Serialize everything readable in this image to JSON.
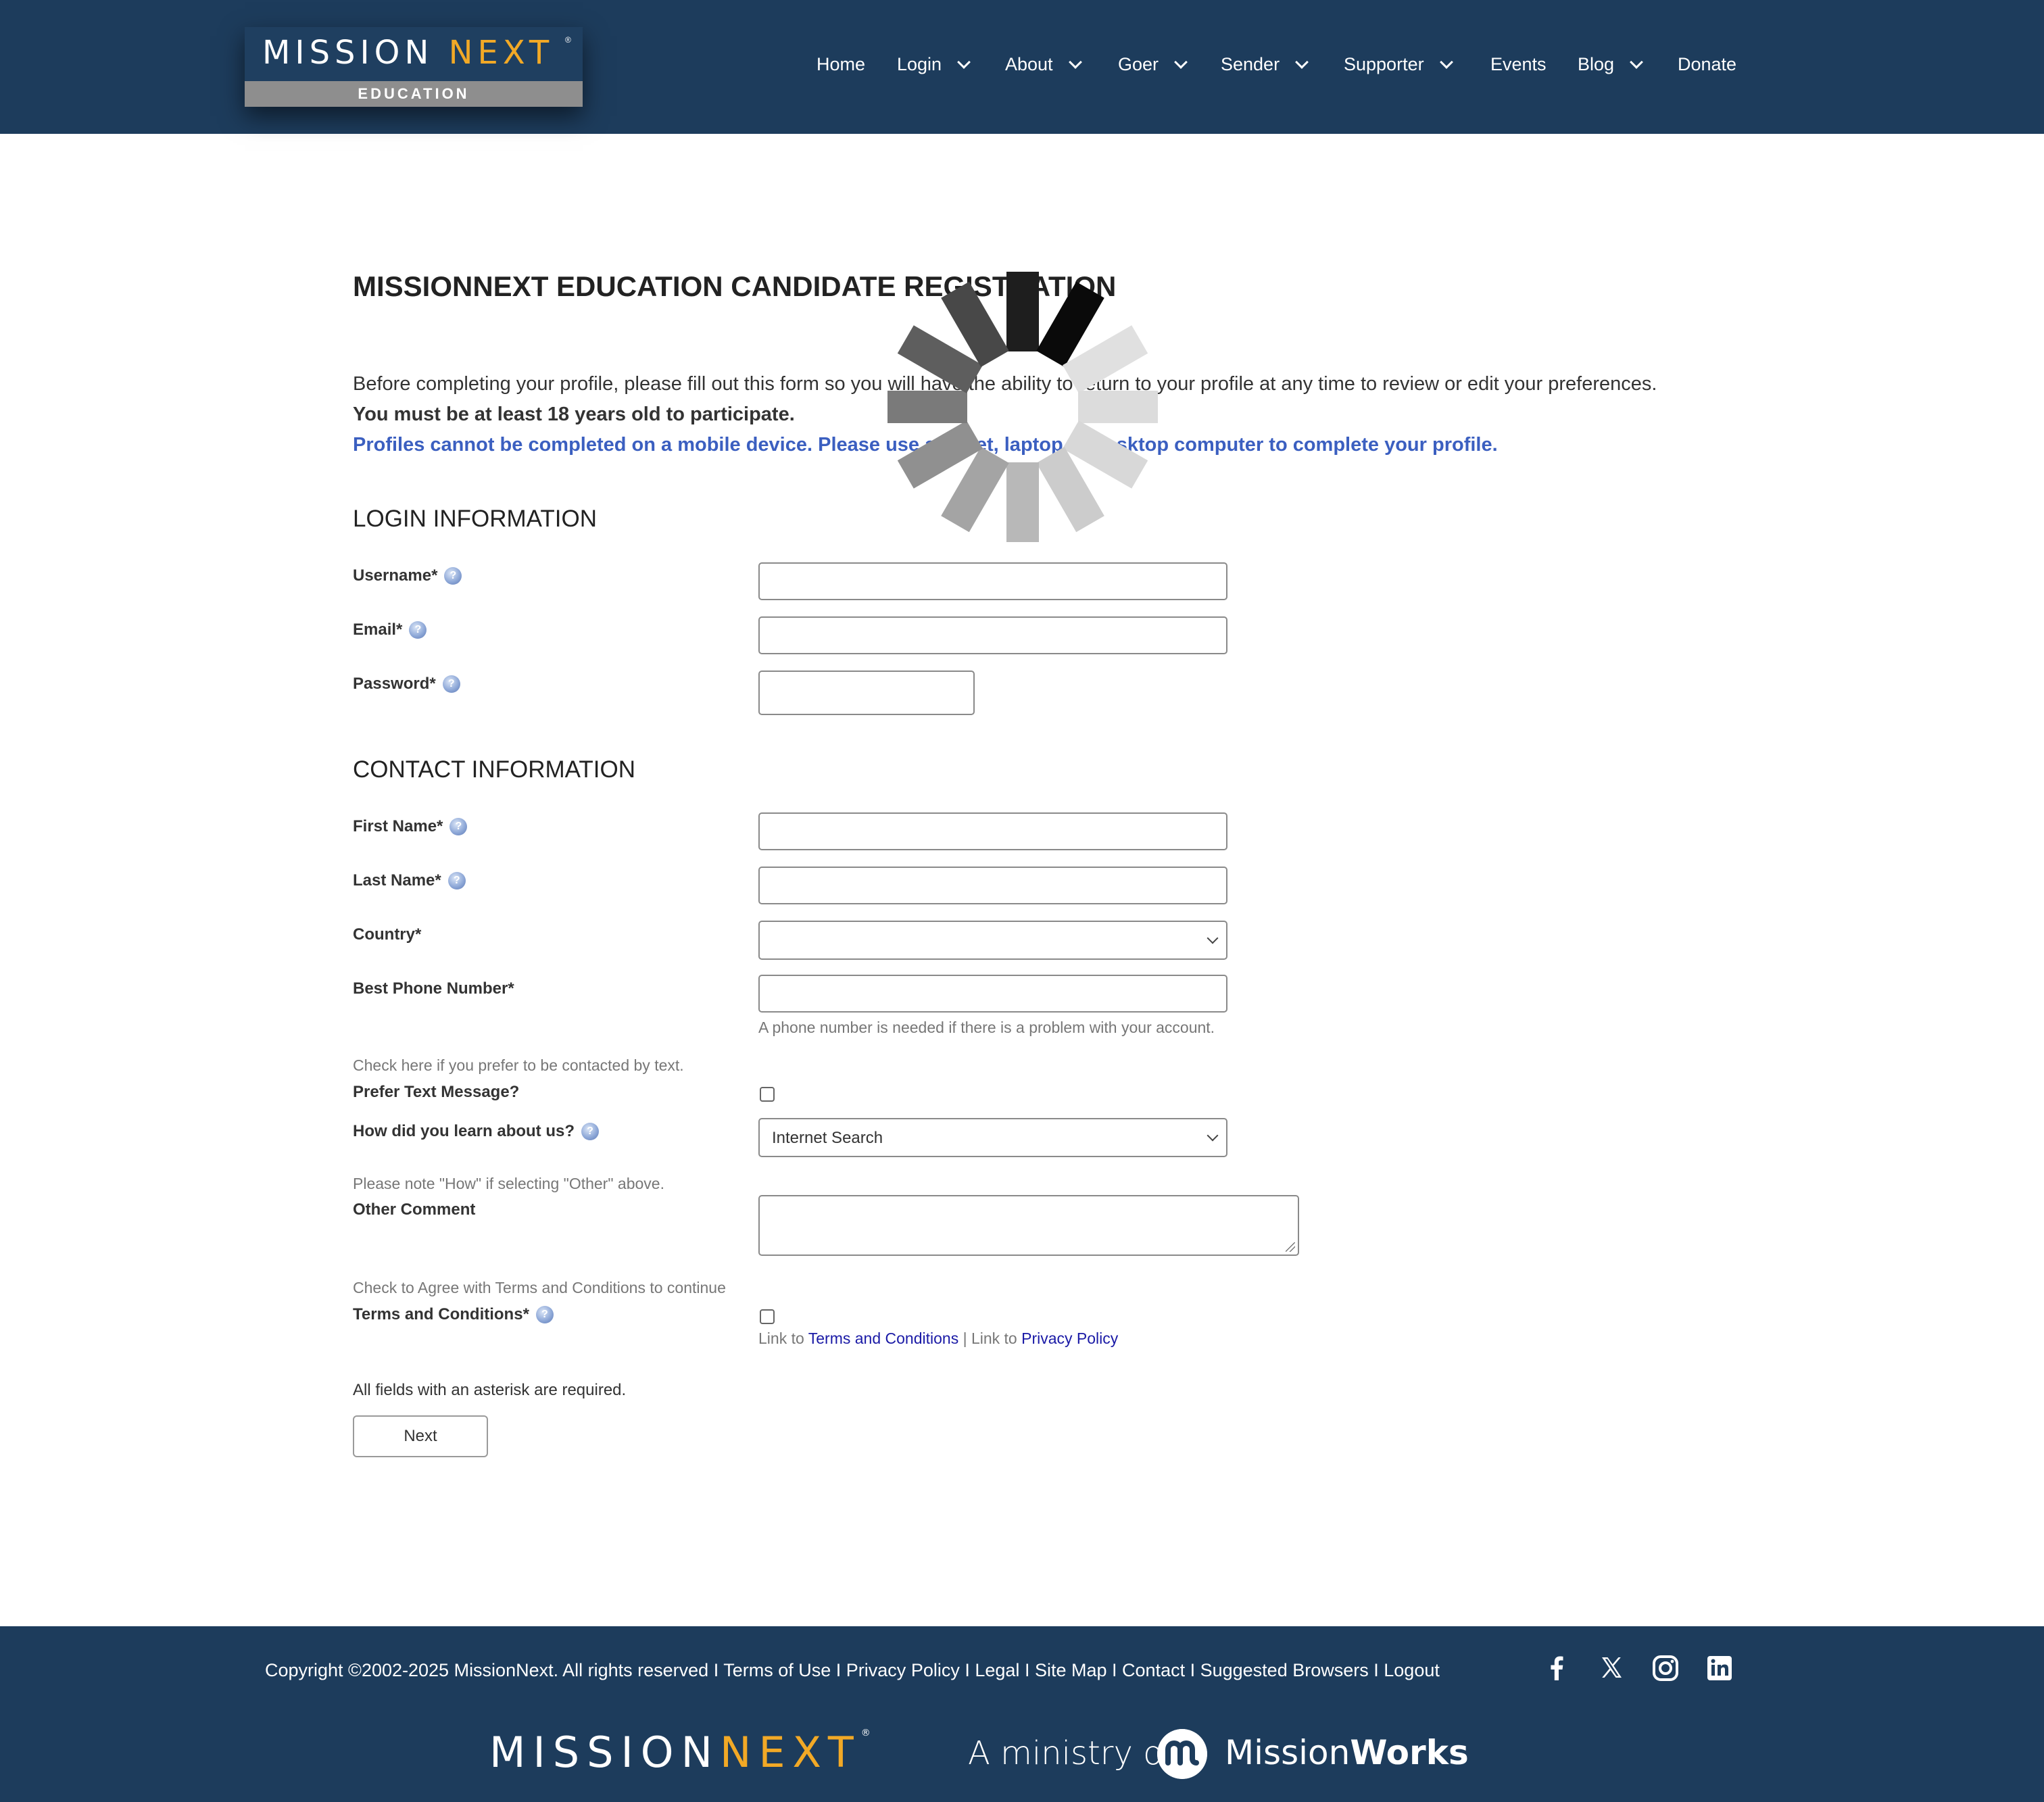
{
  "header": {
    "logo_word_a": "MISSION",
    "logo_word_b": "NEXT",
    "logo_reg": "®",
    "logo_sub": "EDUCATION",
    "nav": [
      {
        "label": "Home"
      },
      {
        "label": "Login"
      },
      {
        "label": "About"
      },
      {
        "label": "Goer"
      },
      {
        "label": "Sender"
      },
      {
        "label": "Supporter"
      },
      {
        "label": "Events"
      },
      {
        "label": "Blog"
      },
      {
        "label": "Donate"
      }
    ]
  },
  "main": {
    "title": "MISSIONNEXT EDUCATION CANDIDATE REGISTRATION",
    "intro_line1": "Before completing your profile, please fill out this form so you will have the ability to return to your profile at any time to review or edit your preferences.",
    "intro_line2": "You must be at least 18 years old to participate.",
    "intro_line3": "Profiles cannot be completed on a mobile device. Please use a tablet, laptop or desktop computer to complete your profile.",
    "login_section": "LOGIN INFORMATION",
    "contact_section": "CONTACT INFORMATION",
    "help_glyph": "?",
    "fields": {
      "username": "Username*",
      "email": "Email*",
      "password": "Password*",
      "first_name": "First Name*",
      "last_name": "Last Name*",
      "country": "Country*",
      "phone": "Best Phone Number*",
      "phone_hint": "A phone number is needed if there is a problem with your account.",
      "text_hint": "Check here if you prefer to be contacted by text.",
      "prefer_text": "Prefer Text Message?",
      "learn": "How did you learn about us?",
      "learn_value": "Internet Search",
      "other_hint": "Please note \"How\" if selecting \"Other\" above.",
      "other_comment": "Other Comment",
      "terms_hint": "Check to Agree with Terms and Conditions to continue",
      "terms": "Terms and Conditions*",
      "link_to_1": "Link to ",
      "terms_link": "Terms and Conditions",
      "separator": " | Link to ",
      "privacy_link": "Privacy Policy"
    },
    "required_note": "All fields with an asterisk are required.",
    "next_button": "Next"
  },
  "footer": {
    "copyright": "Copyright ©2002-2025 MissionNext. All rights reserved",
    "links": [
      "Terms of Use",
      "Privacy Policy",
      "Legal",
      "Site Map",
      "Contact",
      "Suggested Browsers",
      "Logout"
    ],
    "divider": " I ",
    "logo_word_a": "MISSION",
    "logo_word_b": "NEXT",
    "logo_reg": "®",
    "ministry_text": "A ministry of",
    "mw_a": "Mission",
    "mw_b": "Works",
    "social": [
      "facebook-icon",
      "x-icon",
      "instagram-icon",
      "linkedin-icon"
    ]
  },
  "colors": {
    "brand_navy": "#1d3c5c",
    "brand_gold": "#f2a926",
    "notice_blue": "#3b5fc0",
    "link_blue": "#1a1aa6"
  }
}
